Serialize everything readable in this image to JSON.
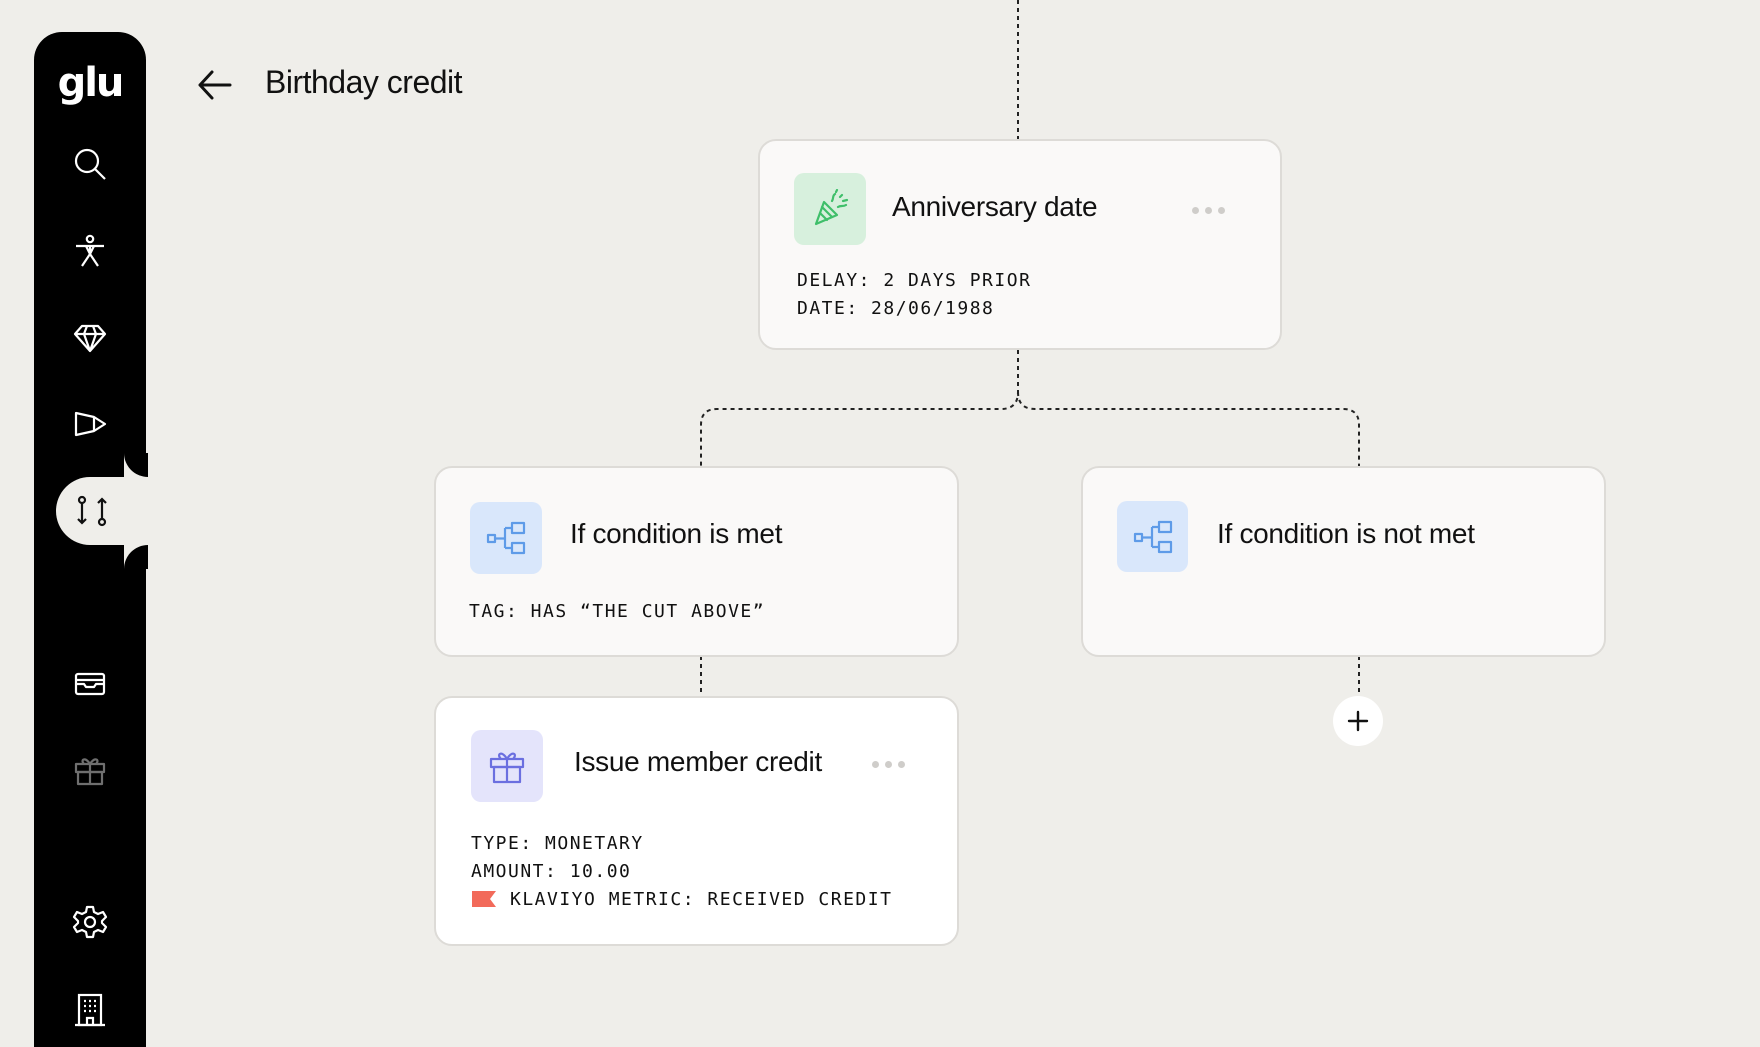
{
  "app": {
    "logo": "glu"
  },
  "header": {
    "title": "Birthday credit"
  },
  "sidebar": {
    "items": [
      {
        "icon": "search-icon"
      },
      {
        "icon": "person-icon"
      },
      {
        "icon": "diamond-icon"
      },
      {
        "icon": "megaphone-icon"
      },
      {
        "icon": "workflow-icon",
        "active": true
      },
      {
        "icon": "wallet-icon"
      },
      {
        "icon": "gift-icon"
      },
      {
        "icon": "gear-icon"
      },
      {
        "icon": "building-icon"
      }
    ]
  },
  "flow": {
    "trigger": {
      "title": "Anniversary date",
      "details": [
        "DELAY: 2 DAYS PRIOR",
        "DATE: 28/06/1988"
      ]
    },
    "branch_met": {
      "title": "If condition is met",
      "details": [
        "TAG: HAS “THE CUT ABOVE”"
      ]
    },
    "branch_not_met": {
      "title": "If condition is not met"
    },
    "action": {
      "title": "Issue member credit",
      "details": [
        "TYPE: MONETARY",
        "AMOUNT: 10.00",
        "KLAVIYO METRIC: RECEIVED CREDIT"
      ]
    }
  },
  "colors": {
    "trigger_icon_bg": "#d7f0dd",
    "trigger_icon_fg": "#3fbf6a",
    "branch_icon_bg": "#d9e7fb",
    "branch_icon_fg": "#5e9be8",
    "action_icon_bg": "#e4e4fb",
    "action_icon_fg": "#6b6fe0",
    "klaviyo_flag": "#f26a5a"
  }
}
